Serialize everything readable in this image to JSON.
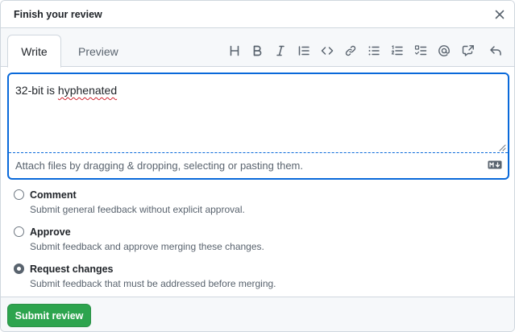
{
  "dialog": {
    "title": "Finish your review",
    "close_icon": "close-icon"
  },
  "tabs": [
    {
      "label": "Write",
      "active": true
    },
    {
      "label": "Preview",
      "active": false
    }
  ],
  "toolbar": {
    "icons": [
      "heading-icon",
      "bold-icon",
      "italic-icon",
      "quote-icon",
      "code-icon",
      "link-icon",
      "unordered-list-icon",
      "ordered-list-icon",
      "task-list-icon",
      "mention-icon",
      "cross-reference-icon",
      "reply-icon"
    ]
  },
  "editor": {
    "text_prefix": "32-bit is ",
    "text_misspelled": "hyphenated",
    "attach_hint": "Attach files by dragging & dropping, selecting or pasting them.",
    "markdown_icon": "markdown-icon"
  },
  "options": [
    {
      "label": "Comment",
      "description": "Submit general feedback without explicit approval.",
      "checked": false
    },
    {
      "label": "Approve",
      "description": "Submit feedback and approve merging these changes.",
      "checked": false
    },
    {
      "label": "Request changes",
      "description": "Submit feedback that must be addressed before merging.",
      "checked": true
    }
  ],
  "footer": {
    "submit_label": "Submit review"
  },
  "colors": {
    "accent": "#0969da",
    "submit_bg": "#2da44e",
    "muted_text": "#59636e"
  }
}
